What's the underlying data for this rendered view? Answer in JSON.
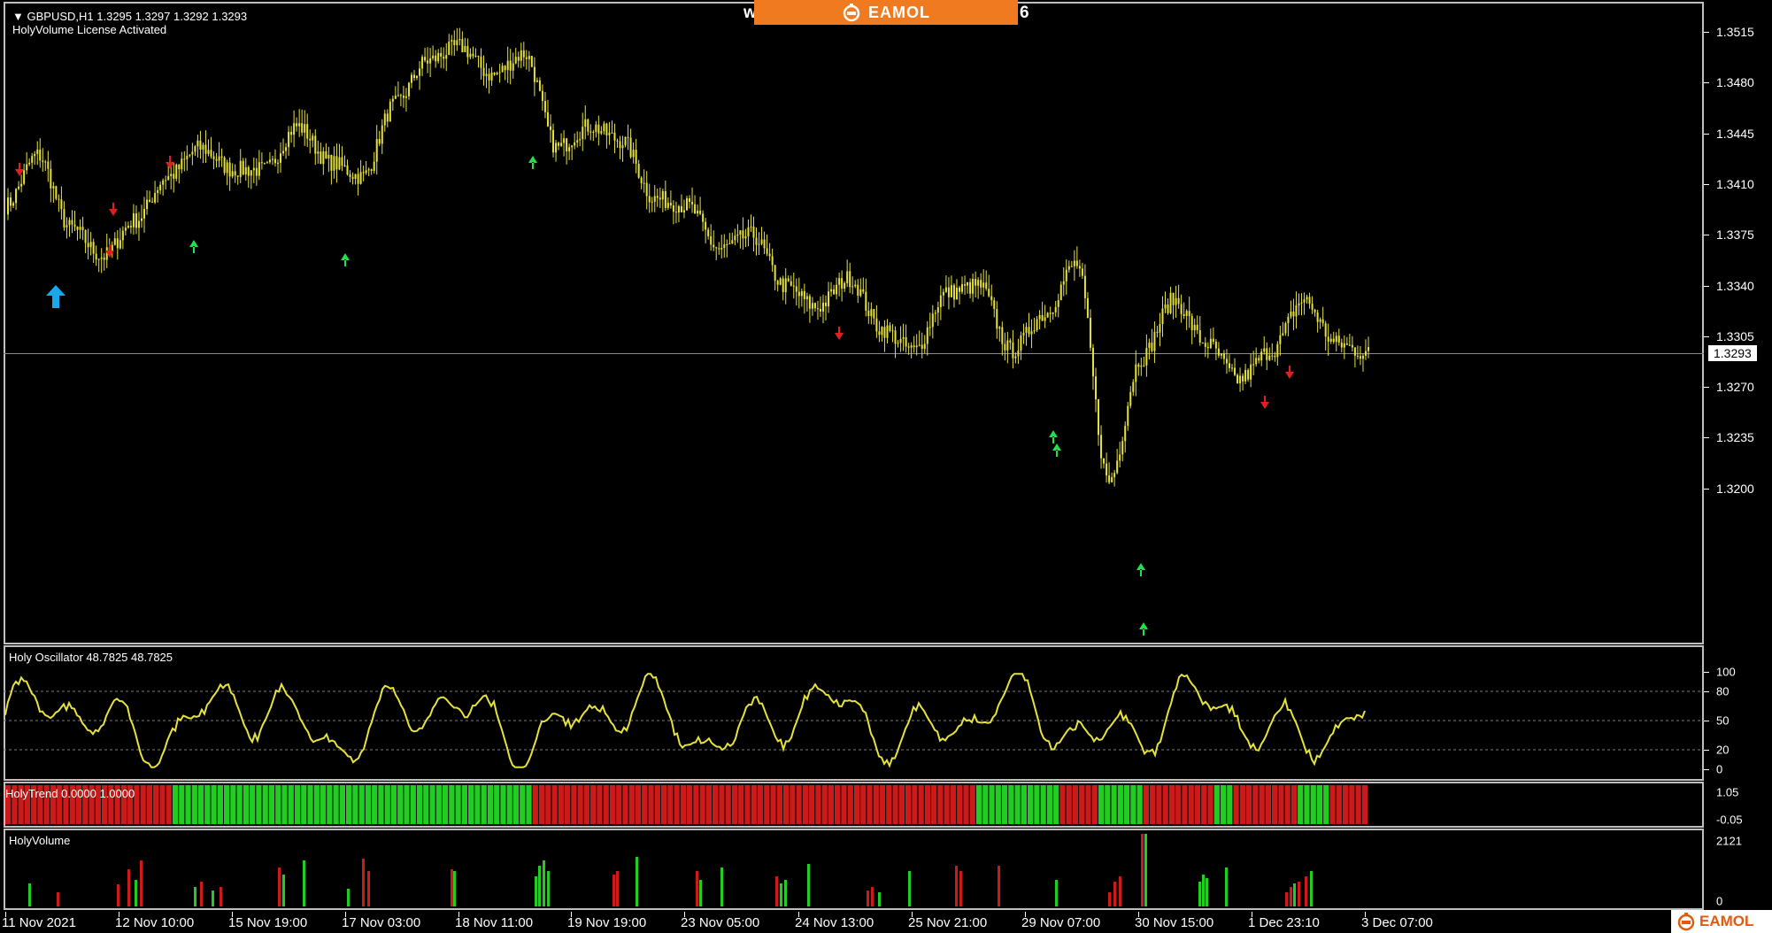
{
  "window": {
    "symbol_title": "GBPUSD,H1  1.3295 1.3297 1.3292 1.3293",
    "license_text": "HolyVolume License Activated",
    "banner_left_char": "w",
    "banner_right_char": "6",
    "banner_brand": "EAMOL"
  },
  "colors": {
    "background": "#000000",
    "candle": "#e6e23c",
    "up_arrow": "#22e04a",
    "down_arrow": "#e02020",
    "big_arrow": "#19a8e8",
    "trend_green": "#22cc22",
    "trend_red": "#cc1a1a",
    "banner": "#f07a20"
  },
  "price_axis": {
    "labels": [
      "1.3515",
      "1.3480",
      "1.3445",
      "1.3410",
      "1.3375",
      "1.3340",
      "1.3305",
      "1.3270",
      "1.3235",
      "1.3200"
    ],
    "current_price": "1.3293"
  },
  "oscillator": {
    "title": "Holy Oscillator 48.7825 48.7825",
    "levels": [
      "100",
      "80",
      "50",
      "20",
      "0"
    ]
  },
  "trend": {
    "title": "HolyTrend 0.0000 1.0000",
    "levels": [
      "1.05",
      "-0.05"
    ],
    "segments": [
      {
        "color": "red",
        "bars": 26
      },
      {
        "color": "green",
        "bars": 56
      },
      {
        "color": "red",
        "bars": 69
      },
      {
        "color": "green",
        "bars": 13
      },
      {
        "color": "red",
        "bars": 6
      },
      {
        "color": "green",
        "bars": 7
      },
      {
        "color": "red",
        "bars": 11
      },
      {
        "color": "green",
        "bars": 3
      },
      {
        "color": "red",
        "bars": 10
      },
      {
        "color": "green",
        "bars": 5
      },
      {
        "color": "red",
        "bars": 6
      }
    ]
  },
  "volume": {
    "title": "HolyVolume",
    "levels": [
      "2121",
      "0"
    ]
  },
  "time_axis": {
    "labels": [
      "11 Nov 2021",
      "12 Nov 10:00",
      "15 Nov 19:00",
      "17 Nov 03:00",
      "18 Nov 11:00",
      "19 Nov 19:00",
      "23 Nov 05:00",
      "24 Nov 13:00",
      "25 Nov 21:00",
      "29 Nov 07:00",
      "30 Nov 15:00",
      "1 Dec 23:10",
      "3 Dec 07:00"
    ]
  },
  "chart_data": {
    "type": "candlestick",
    "symbol": "GBPUSD",
    "timeframe": "H1",
    "ylim": [
      1.318,
      1.353
    ],
    "series": [
      {
        "name": "price",
        "waypoints": [
          [
            "11 Nov 2021",
            1.3395
          ],
          [
            "",
            1.343
          ],
          [
            "",
            1.338
          ],
          [
            "",
            1.336
          ],
          [
            "12 Nov 10:00",
            1.3385
          ],
          [
            "",
            1.3415
          ],
          [
            "",
            1.3435
          ],
          [
            "",
            1.342
          ],
          [
            "15 Nov 19:00",
            1.342
          ],
          [
            "",
            1.345
          ],
          [
            "",
            1.3425
          ],
          [
            "17 Nov 03:00",
            1.3415
          ],
          [
            "",
            1.3465
          ],
          [
            "",
            1.3495
          ],
          [
            "",
            1.3505
          ],
          [
            "18 Nov 11:00",
            1.3485
          ],
          [
            "",
            1.35
          ],
          [
            "",
            1.3435
          ],
          [
            "",
            1.345
          ],
          [
            "19 Nov 19:00",
            1.344
          ],
          [
            "",
            1.34
          ],
          [
            "",
            1.3395
          ],
          [
            "23 Nov 05:00",
            1.3365
          ],
          [
            "",
            1.3375
          ],
          [
            "",
            1.334
          ],
          [
            "24 Nov 13:00",
            1.3325
          ],
          [
            "",
            1.3345
          ],
          [
            "",
            1.331
          ],
          [
            "25 Nov 21:00",
            1.3295
          ],
          [
            "",
            1.3335
          ],
          [
            "",
            1.334
          ],
          [
            "29 Nov 07:00",
            1.3295
          ],
          [
            "",
            1.332
          ],
          [
            "",
            1.3355
          ],
          [
            "30 Nov 15:00",
            1.3205
          ],
          [
            "",
            1.329
          ],
          [
            "",
            1.333
          ],
          [
            "",
            1.33
          ],
          [
            "",
            1.3275
          ],
          [
            "1 Dec 23:10",
            1.3295
          ],
          [
            "",
            1.333
          ],
          [
            "",
            1.33
          ],
          [
            "3 Dec 07:00",
            1.3293
          ]
        ]
      }
    ],
    "oscillator_range": [
      0,
      100
    ],
    "oscillator_levels": [
      80,
      50,
      20
    ],
    "volume_max": 2121
  }
}
